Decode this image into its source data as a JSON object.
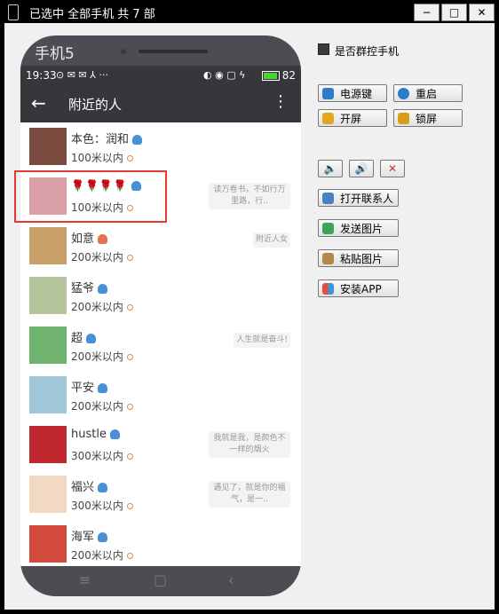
{
  "window": {
    "title": "已选中 全部手机 共 7 部",
    "minimize": "−",
    "maximize": "□",
    "close": "✕"
  },
  "phone": {
    "label": "手机5",
    "status": {
      "time": "19:33",
      "icons": "⊙ ✉ ✉ ⅄ ···",
      "right_icons": "◐ ◉ ▢ ϟ",
      "battery": "82"
    },
    "appbar": {
      "title": "附近的人"
    },
    "contacts": [
      {
        "name": "本色：润和",
        "distance": "100米以内",
        "signature": "",
        "gender": "m",
        "avatar_color": "#7a4b3e"
      },
      {
        "name": "🌹🌹🌹🌹",
        "distance": "100米以内",
        "signature": "读万卷书，不如行万里路，行..",
        "gender": "m",
        "avatar_color": "#d9a0a8"
      },
      {
        "name": "如意",
        "distance": "200米以内",
        "signature": "附近人女",
        "gender": "f",
        "avatar_color": "#c9a06a"
      },
      {
        "name": "猛爷",
        "distance": "200米以内",
        "signature": "",
        "gender": "m",
        "avatar_color": "#b5c49a"
      },
      {
        "name": "超",
        "distance": "200米以内",
        "signature": "人生就是奋斗!",
        "gender": "m",
        "avatar_color": "#6fb36f"
      },
      {
        "name": "平安",
        "distance": "200米以内",
        "signature": "",
        "gender": "m",
        "avatar_color": "#9fc7d8"
      },
      {
        "name": "hustle",
        "distance": "300米以内",
        "signature": "我就是我，是颜色不一样的烟火",
        "gender": "m",
        "avatar_color": "#c0282f"
      },
      {
        "name": "福兴",
        "distance": "300米以内",
        "signature": "遇见了，就是你的福气，是一..",
        "gender": "m",
        "avatar_color": "#f2d9c4"
      },
      {
        "name": "海军",
        "distance": "200米以内",
        "signature": "",
        "gender": "m",
        "avatar_color": "#d24a3b"
      }
    ]
  },
  "controls": {
    "group_control_label": "是否群控手机",
    "power": "电源键",
    "reboot": "重启",
    "unlock": "开屏",
    "lock": "锁屏",
    "vol_down_icon": "🔈",
    "vol_up_icon": "🔊",
    "mute_icon": "✕",
    "open_contacts": "打开联系人",
    "send_image": "发送图片",
    "paste_image": "粘贴图片",
    "install_app": "安装APP"
  },
  "colors": {
    "accent": "#4a90d9",
    "highlight": "#e53935",
    "phone_body": "#4c4c52"
  }
}
